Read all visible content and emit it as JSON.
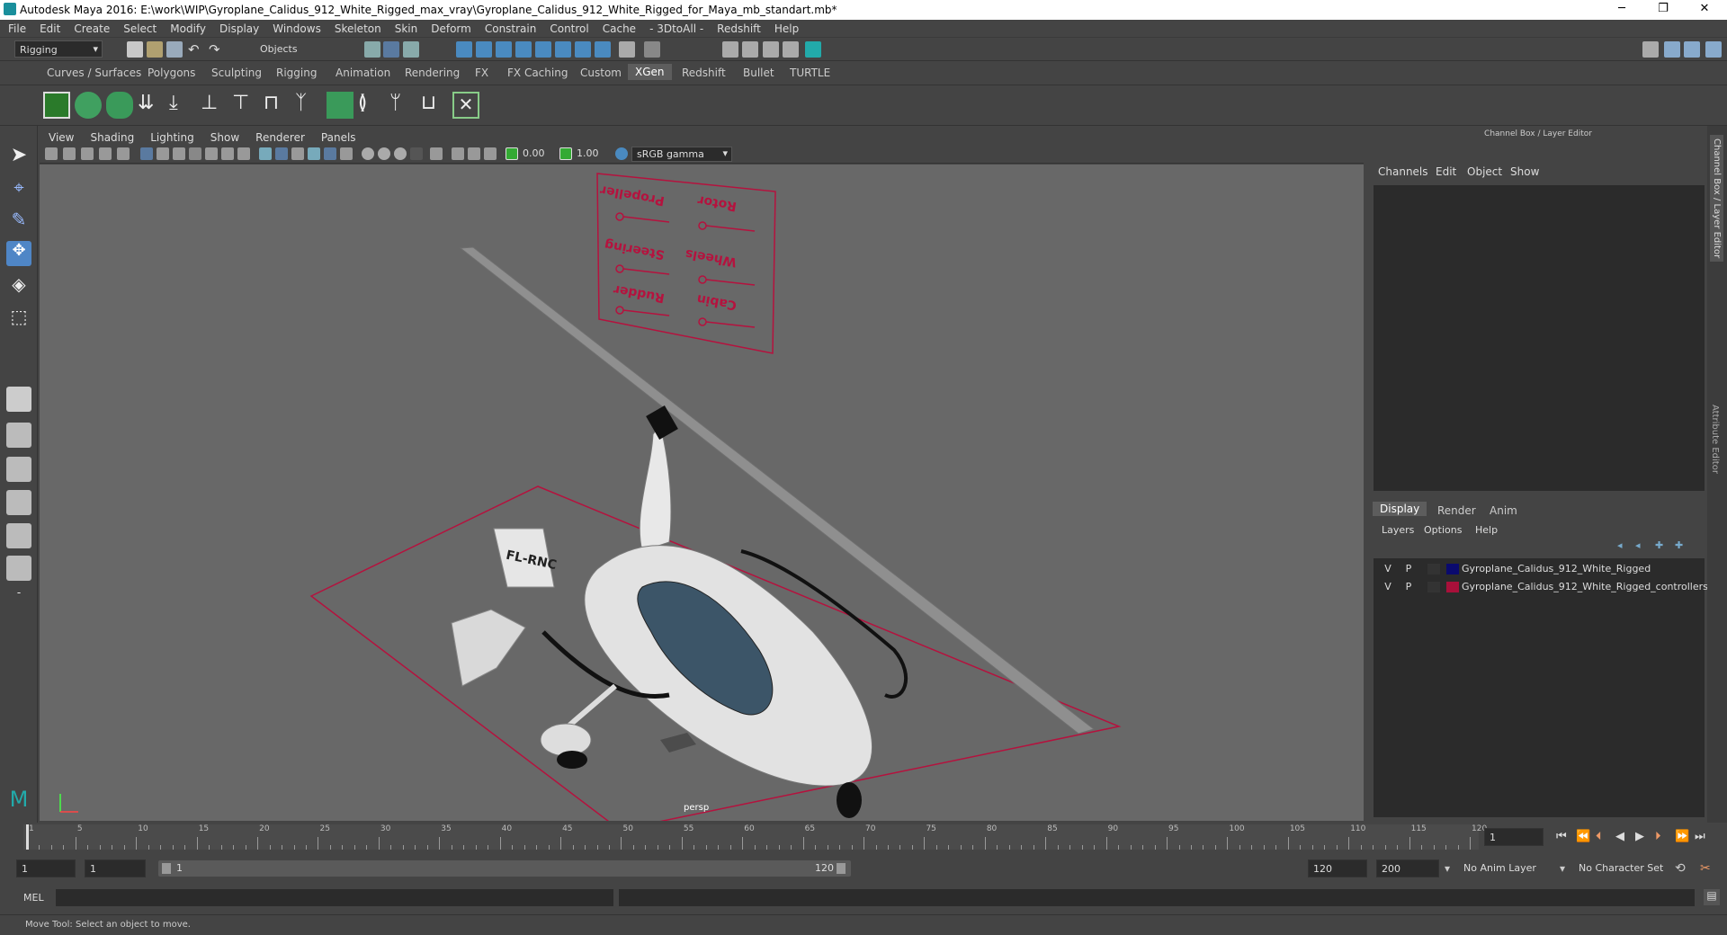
{
  "window": {
    "title": "Autodesk Maya 2016: E:\\work\\WIP\\Gyroplane_Calidus_912_White_Rigged_max_vray\\Gyroplane_Calidus_912_White_Rigged_for_Maya_mb_standart.mb*",
    "minimize": "─",
    "maximize": "❐",
    "close": "✕"
  },
  "menus": [
    "File",
    "Edit",
    "Create",
    "Select",
    "Modify",
    "Display",
    "Windows",
    "Skeleton",
    "Skin",
    "Deform",
    "Constrain",
    "Control",
    "Cache",
    "- 3DtoAll -",
    "Redshift",
    "Help"
  ],
  "status": {
    "mode": "Rigging",
    "selection": "Objects"
  },
  "shelf_tabs": [
    "Curves / Surfaces",
    "Polygons",
    "Sculpting",
    "Rigging",
    "Animation",
    "Rendering",
    "FX",
    "FX Caching",
    "Custom",
    "XGen",
    "Redshift",
    "Bullet",
    "TURTLE"
  ],
  "shelf_active": "XGen",
  "viewport": {
    "menus": [
      "View",
      "Shading",
      "Lighting",
      "Show",
      "Renderer",
      "Panels"
    ],
    "val1": "0.00",
    "val2": "1.00",
    "colorspace": "sRGB gamma",
    "camera": "persp"
  },
  "scene": {
    "registration": "FL-RNC",
    "panel_labels": [
      "Propeller",
      "Rotor",
      "Steering",
      "Wheels",
      "Rudder",
      "Cabin"
    ]
  },
  "right": {
    "title": "Channel Box / Layer Editor",
    "menus": [
      "Channels",
      "Edit",
      "Object",
      "Show"
    ],
    "tabs": [
      "Display",
      "Render",
      "Anim"
    ],
    "layer_menus": [
      "Layers",
      "Options",
      "Help"
    ],
    "layers": [
      {
        "v": "V",
        "p": "P",
        "color": "#0a0a6e",
        "name": "Gyroplane_Calidus_912_White_Rigged"
      },
      {
        "v": "V",
        "p": "P",
        "color": "#a8103a",
        "name": "Gyroplane_Calidus_912_White_Rigged_controllers"
      }
    ],
    "side_tab1": "Channel Box / Layer Editor",
    "side_tab2": "Attribute Editor"
  },
  "timeline": {
    "ticks": [
      "1",
      "5",
      "10",
      "15",
      "20",
      "25",
      "30",
      "35",
      "40",
      "45",
      "50",
      "55",
      "60",
      "65",
      "70",
      "75",
      "80",
      "85",
      "90",
      "95",
      "100",
      "105",
      "110",
      "115",
      "120"
    ],
    "current": "1"
  },
  "range": {
    "start": "1",
    "play_start": "1",
    "slider_start": "1",
    "slider_end": "120",
    "play_end": "120",
    "end": "200",
    "anim_layer": "No Anim Layer",
    "char_set": "No Character Set"
  },
  "cmd": {
    "label": "MEL"
  },
  "help": "Move Tool: Select an object to move."
}
